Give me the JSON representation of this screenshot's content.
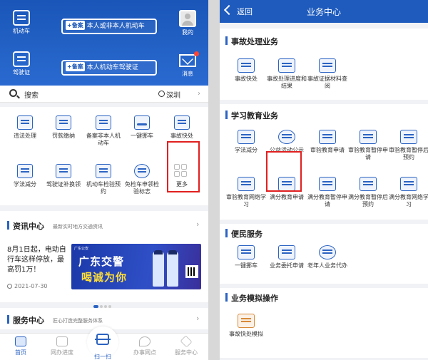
{
  "left": {
    "hero": {
      "row1": {
        "icon_label": "机动车",
        "pill_tag": "+备案",
        "pill_text": "本人或非本人机动车",
        "right_label": "我的"
      },
      "row2": {
        "icon_label": "驾驶证",
        "pill_tag": "+备案",
        "pill_text": "本人机动车驾驶证",
        "right_label": "消息"
      }
    },
    "search": {
      "label": "搜索",
      "location": "深圳"
    },
    "grid": [
      {
        "label": "违法处理",
        "icon": "traffic-violation-icon"
      },
      {
        "label": "罚款缴纳",
        "icon": "fine-payment-icon"
      },
      {
        "label": "备案非本人机动车",
        "icon": "vehicle-register-icon"
      },
      {
        "label": "一键挪车",
        "icon": "move-car-icon"
      },
      {
        "label": "事故快处",
        "icon": "accident-icon"
      },
      {
        "label": "学法减分",
        "icon": "study-law-icon"
      },
      {
        "label": "驾驶证补换领",
        "icon": "license-renew-icon"
      },
      {
        "label": "机动车检验预约",
        "icon": "vehicle-inspection-icon"
      },
      {
        "label": "免检车申领检验标志",
        "icon": "inspection-badge-icon"
      },
      {
        "label": "更多",
        "icon": "more-apps-icon"
      }
    ],
    "news": {
      "title": "资讯中心",
      "subtitle": "最新实时地方交通资讯",
      "headline": "8月1日起，电动自行车这样停放，最高罚1万！",
      "date": "2021-07-30",
      "banner": {
        "brand": "广东公安",
        "line1": "广东交警",
        "line2": "喝诚为你"
      }
    },
    "service": {
      "title": "服务中心",
      "subtitle": "匠心打造完整服务体系"
    },
    "tabbar": {
      "home": "首页",
      "progress": "网办进度",
      "scan": "扫一扫",
      "outlets": "办事网点",
      "service": "服务中心"
    }
  },
  "right": {
    "nav": {
      "back": "返回",
      "title": "业务中心"
    },
    "sections": [
      {
        "title": "事故处理业务",
        "items": [
          "事故快处",
          "事故处理进度和结果",
          "事故证据材料查阅"
        ]
      },
      {
        "title": "学习教育业务",
        "items": [
          "学法减分",
          "公益活动公示",
          "审验教育申请",
          "审验教育暂停申请",
          "审验教育暂停后预约",
          "审验教育网络学习",
          "满分教育申请",
          "满分教育暂停申请",
          "满分教育暂停后预约",
          "满分教育网络学习"
        ]
      },
      {
        "title": "便民服务",
        "items": [
          "一键挪车",
          "业务委托申请",
          "老年人业务代办"
        ]
      },
      {
        "title": "业务模拟操作",
        "items": [
          "事故快处模拟"
        ]
      }
    ]
  },
  "colors": {
    "primary": "#1e5bbd",
    "highlight": "#e0201f",
    "accent_orange": "#d88a3a"
  }
}
